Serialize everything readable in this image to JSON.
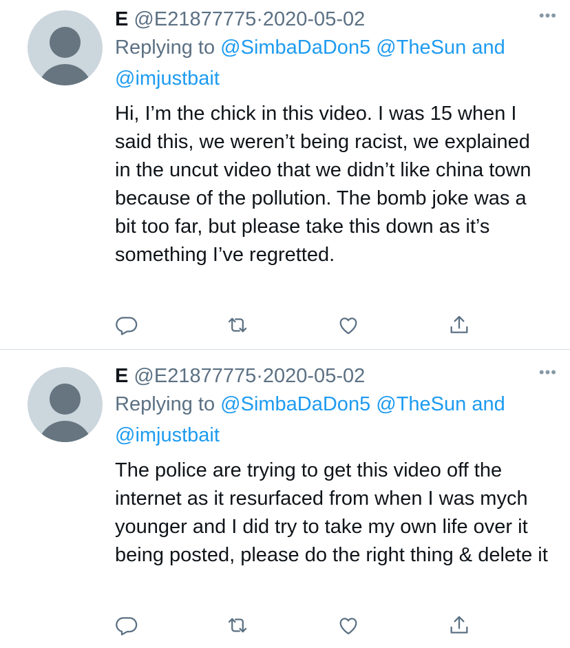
{
  "tweets": [
    {
      "display_name": "E",
      "handle": "@E21877775",
      "separator": "·",
      "date": "2020-05-02",
      "more_label": "•••",
      "replying_prefix": "Replying to",
      "mentions": [
        "@SimbaDaDon5",
        "@TheSun"
      ],
      "and_word": "and",
      "last_mention": "@imjustbait",
      "text": "Hi, I’m the chick in this video. I was 15 when I said this, we weren’t being racist, we explained in the uncut video that we didn’t like china town because of the pollution. The bomb joke was a bit too far, but please take this down as it’s something I’ve regretted.",
      "icons": [
        "reply-icon",
        "retweet-icon",
        "like-icon",
        "share-icon"
      ]
    },
    {
      "display_name": "E",
      "handle": "@E21877775",
      "separator": "·",
      "date": "2020-05-02",
      "more_label": "•••",
      "replying_prefix": "Replying to",
      "mentions": [
        "@SimbaDaDon5",
        "@TheSun"
      ],
      "and_word": "and",
      "last_mention": "@imjustbait",
      "text": "The police are trying to get this video off the internet as it resurfaced from when I was mych younger and I did try to take my own life over it being posted, please do the right thing & delete it",
      "icons": [
        "reply-icon",
        "retweet-icon",
        "like-icon",
        "share-icon"
      ]
    }
  ],
  "colors": {
    "text": "#0f1419",
    "secondary": "#5b7083",
    "link": "#1d9bf0",
    "icon": "#5b7083",
    "avatar_bg": "#ccd6dd",
    "avatar_fg": "#66757f",
    "divider": "#d6dde3"
  }
}
